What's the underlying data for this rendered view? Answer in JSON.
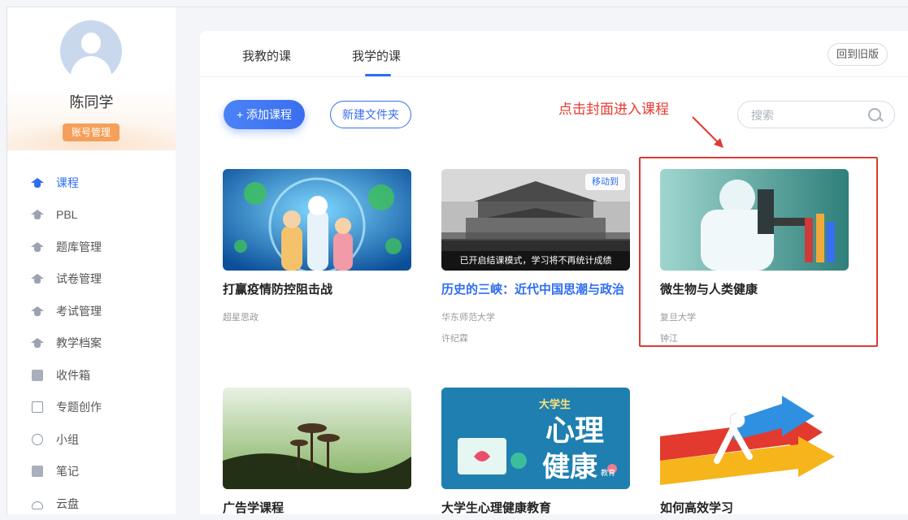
{
  "user": {
    "name": "陈同学",
    "account_button": "账号管理"
  },
  "sidebar": {
    "items": [
      {
        "label": "课程",
        "icon": "graduation-cap-icon",
        "active": true
      },
      {
        "label": "PBL",
        "icon": "graduation-cap-icon"
      },
      {
        "label": "题库管理",
        "icon": "graduation-cap-icon"
      },
      {
        "label": "试卷管理",
        "icon": "graduation-cap-icon"
      },
      {
        "label": "考试管理",
        "icon": "graduation-cap-icon"
      },
      {
        "label": "教学档案",
        "icon": "graduation-cap-icon"
      },
      {
        "label": "收件箱",
        "icon": "inbox-icon"
      },
      {
        "label": "专题创作",
        "icon": "window-icon"
      },
      {
        "label": "小组",
        "icon": "group-icon"
      },
      {
        "label": "笔记",
        "icon": "note-icon"
      },
      {
        "label": "云盘",
        "icon": "cloud-icon"
      }
    ]
  },
  "tabs": [
    {
      "label": "我教的课"
    },
    {
      "label": "我学的课",
      "active": true
    }
  ],
  "old_version_button": "回到旧版",
  "actions": {
    "add_course": "+ 添加课程",
    "new_folder": "新建文件夹"
  },
  "annotation": "点击封面进入课程",
  "search": {
    "placeholder": "搜索"
  },
  "courses": [
    {
      "title": "打赢疫情防控阻击战",
      "school": "超星思政",
      "teacher": ""
    },
    {
      "title": "历史的三峡：近代中国思潮与政治",
      "school": "华东师范大学",
      "teacher": "许纪霖",
      "tag": "移动到",
      "caption": "已开启结课模式，学习将不再统计成绩"
    },
    {
      "title": "微生物与人类健康",
      "school": "复旦大学",
      "teacher": "钟江"
    },
    {
      "title": "广告学课程"
    },
    {
      "title": "大学生心理健康教育",
      "cover_text": [
        "大学生",
        "心理",
        "健康",
        "教育"
      ]
    },
    {
      "title": "如何高效学习"
    }
  ],
  "colors": {
    "accent": "#2f6ef0",
    "orange": "#f5a05a",
    "annotation_red": "#e03a30"
  }
}
